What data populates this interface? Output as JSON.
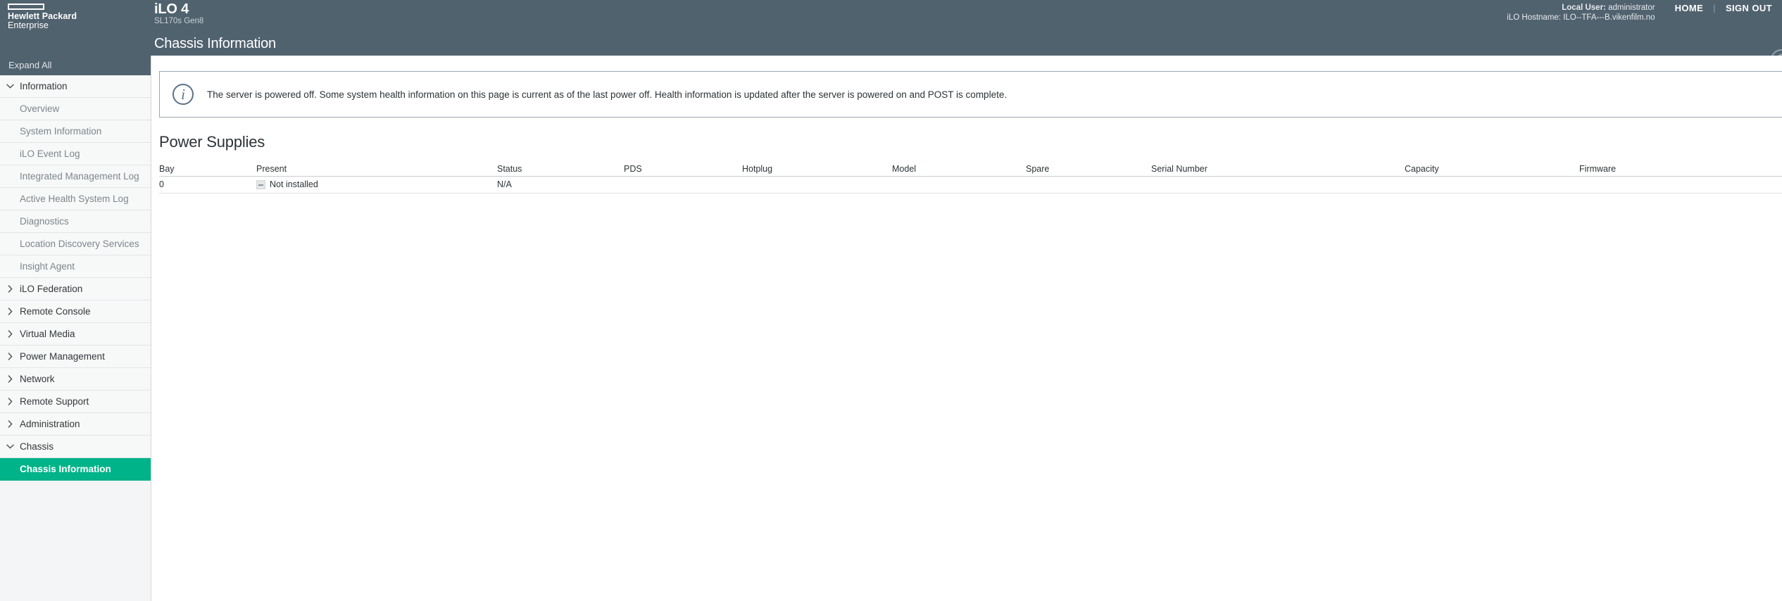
{
  "brand": {
    "line1": "Hewlett Packard",
    "line2": "Enterprise",
    "logo_icon": "hpe-rectangle-logo"
  },
  "product": {
    "name": "iLO 4",
    "model": "SL170s Gen8"
  },
  "session": {
    "local_user_label": "Local User:",
    "local_user_value": "administrator",
    "hostname_label": "iLO Hostname:",
    "hostname_value": "ILO--TFA---B.vikenfilm.no"
  },
  "toplinks": {
    "home": "HOME",
    "divider": "|",
    "sign_out": "SIGN OUT"
  },
  "page": {
    "title": "Chassis Information",
    "help_icon": "?"
  },
  "sidebar": {
    "expand_all": "Expand All",
    "items": [
      {
        "label": "Information",
        "type": "group",
        "state": "expanded",
        "caret": "chevron-down-icon"
      },
      {
        "label": "Overview",
        "type": "leaf",
        "selected": false
      },
      {
        "label": "System Information",
        "type": "leaf",
        "selected": false
      },
      {
        "label": "iLO Event Log",
        "type": "leaf",
        "selected": false
      },
      {
        "label": "Integrated Management Log",
        "type": "leaf",
        "selected": false
      },
      {
        "label": "Active Health System Log",
        "type": "leaf",
        "selected": false
      },
      {
        "label": "Diagnostics",
        "type": "leaf",
        "selected": false
      },
      {
        "label": "Location Discovery Services",
        "type": "leaf",
        "selected": false
      },
      {
        "label": "Insight Agent",
        "type": "leaf",
        "selected": false
      },
      {
        "label": "iLO Federation",
        "type": "group",
        "state": "collapsed",
        "caret": "chevron-right-icon"
      },
      {
        "label": "Remote Console",
        "type": "group",
        "state": "collapsed",
        "caret": "chevron-right-icon"
      },
      {
        "label": "Virtual Media",
        "type": "group",
        "state": "collapsed",
        "caret": "chevron-right-icon"
      },
      {
        "label": "Power Management",
        "type": "group",
        "state": "collapsed",
        "caret": "chevron-right-icon"
      },
      {
        "label": "Network",
        "type": "group",
        "state": "collapsed",
        "caret": "chevron-right-icon"
      },
      {
        "label": "Remote Support",
        "type": "group",
        "state": "collapsed",
        "caret": "chevron-right-icon"
      },
      {
        "label": "Administration",
        "type": "group",
        "state": "collapsed",
        "caret": "chevron-right-icon"
      },
      {
        "label": "Chassis",
        "type": "group",
        "state": "expanded",
        "caret": "chevron-down-icon"
      },
      {
        "label": "Chassis Information",
        "type": "leaf",
        "selected": true
      }
    ]
  },
  "alert": {
    "icon": "info-icon",
    "message": "The server is powered off. Some system health information on this page is current as of the last power off. Health information is updated after the server is powered on and POST is complete."
  },
  "power_supplies": {
    "section_title": "Power Supplies",
    "columns": [
      "Bay",
      "Present",
      "Status",
      "PDS",
      "Hotplug",
      "Model",
      "Spare",
      "Serial Number",
      "Capacity",
      "Firmware"
    ],
    "rows": [
      {
        "bay": "0",
        "present": "Not installed",
        "present_icon": "status-not-installed-icon",
        "status": "N/A",
        "pds": "",
        "hotplug": "",
        "model": "",
        "spare": "",
        "serial_number": "",
        "capacity": "",
        "firmware": ""
      }
    ]
  },
  "colors": {
    "header_bg": "#51626f",
    "accent_green": "#00b388",
    "sidebar_bg": "#f7f8f8",
    "alert_border": "#9aa7b0",
    "content_bg": "#ffffff"
  }
}
